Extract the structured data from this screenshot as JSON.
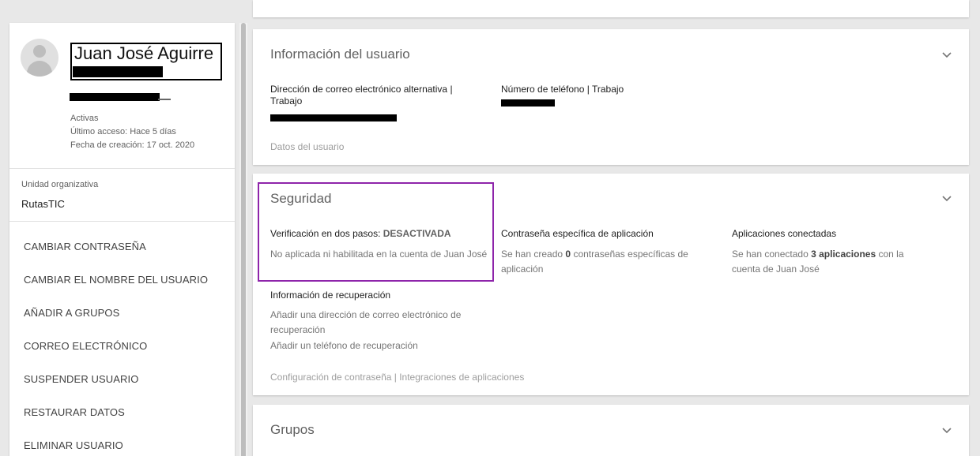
{
  "user": {
    "name": "Juan José Aguirre",
    "status": "Activas",
    "last_access": "Último acceso: Hace 5 días",
    "created": "Fecha de creación: 17 oct. 2020"
  },
  "org_unit": {
    "label": "Unidad organizativa",
    "value": "RutasTIC"
  },
  "actions": [
    "CAMBIAR CONTRASEÑA",
    "CAMBIAR EL NOMBRE DEL USUARIO",
    "AÑADIR A GRUPOS",
    "CORREO ELECTRÓNICO",
    "SUSPENDER USUARIO",
    "RESTAURAR DATOS",
    "ELIMINAR USUARIO"
  ],
  "user_info": {
    "title": "Información del usuario",
    "alt_email_label": "Dirección de correo electrónico alternativa | Trabajo",
    "phone_label": "Número de teléfono | Trabajo",
    "footer_link": "Datos del usuario"
  },
  "security": {
    "title": "Seguridad",
    "two_step_label": "Verificación en dos pasos:",
    "two_step_status": "DESACTIVADA",
    "two_step_desc": "No aplicada ni habilitada en la cuenta de Juan José",
    "app_password_label": "Contraseña específica de aplicación",
    "app_password_pre": "Se han creado",
    "app_password_count": "0",
    "app_password_post": "contraseñas específicas de aplicación",
    "connected_apps_label": "Aplicaciones conectadas",
    "connected_apps_pre": "Se han conectado",
    "connected_apps_count": "3 aplicaciones",
    "connected_apps_post": "con la cuenta de Juan José",
    "recovery_label": "Información de recuperación",
    "recovery_email": "Añadir una dirección de correo electrónico de recuperación",
    "recovery_phone": "Añadir un teléfono de recuperación",
    "footer_link": "Configuración de contraseña | Integraciones de aplicaciones"
  },
  "groups": {
    "title": "Grupos"
  },
  "colors": {
    "highlight": "#8e24aa",
    "background": "#e8e8e8"
  },
  "icons": {
    "expand": "chevron-down-icon",
    "avatar": "user-avatar-icon"
  }
}
